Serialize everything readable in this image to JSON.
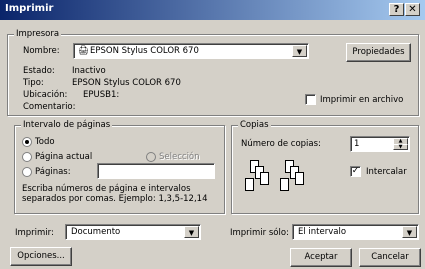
{
  "window": {
    "title": "Imprimir",
    "help_btn": "?",
    "close_btn": "✕"
  },
  "printer": {
    "legend": "Impresora",
    "name_label": "Nombre:",
    "name_value": "EPSON Stylus COLOR 670",
    "properties_button": "Propiedades",
    "status_label": "Estado:",
    "status_value": "Inactivo",
    "type_label": "Tipo:",
    "type_value": "EPSON Stylus COLOR 670",
    "location_label": "Ubicación:",
    "location_value": "EPUSB1:",
    "comment_label": "Comentario:",
    "print_to_file_label": "Imprimir en archivo"
  },
  "range": {
    "legend": "Intervalo de páginas",
    "all_label": "Todo",
    "current_label": "Página actual",
    "selection_label": "Selección",
    "pages_label": "Páginas:",
    "pages_value": "",
    "hint": "Escriba números de página e intervalos separados por comas. Ejemplo: 1,3,5-12,14"
  },
  "copies": {
    "legend": "Copias",
    "count_label": "Número de copias:",
    "count_value": "1",
    "collate_label": "Intercalar",
    "collate_checked": true
  },
  "bottom": {
    "print_label": "Imprimir:",
    "print_value": "Documento",
    "print_only_label": "Imprimir sólo:",
    "print_only_value": "El intervalo",
    "options_button": "Opciones...",
    "accept_button": "Aceptar",
    "cancel_button": "Cancelar"
  }
}
